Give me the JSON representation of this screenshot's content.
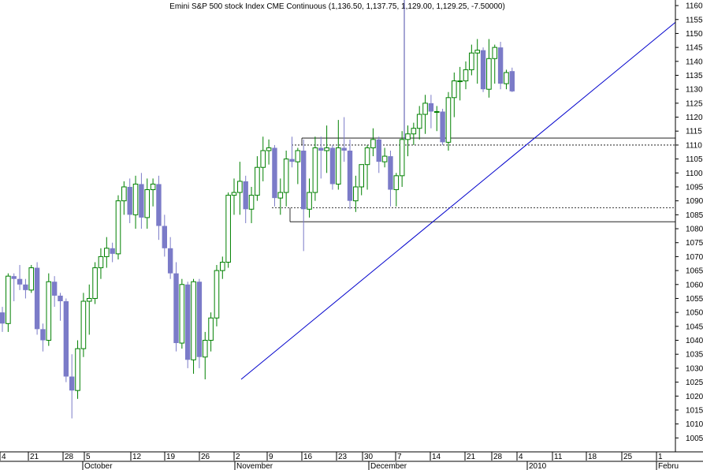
{
  "chart_data": {
    "type": "candlestick",
    "title": "Emini S&P 500 stock Index CME Continuous (1,136.50, 1,137.75, 1,129.00, 1,129.25, -7.50000)",
    "y_range": [
      1000,
      1162
    ],
    "y_ticks": [
      1005,
      1010,
      1015,
      1020,
      1025,
      1030,
      1035,
      1040,
      1045,
      1050,
      1055,
      1060,
      1065,
      1070,
      1075,
      1080,
      1085,
      1090,
      1095,
      1100,
      1105,
      1110,
      1115,
      1120,
      1125,
      1130,
      1135,
      1140,
      1145,
      1150,
      1155,
      1160
    ],
    "x_day_labels": [
      "4",
      "21",
      "28",
      "5",
      "12",
      "19",
      "26",
      "2",
      "9",
      "16",
      "23",
      "30",
      "7",
      "14",
      "21",
      "28",
      "4",
      "11",
      "18",
      "25",
      "1"
    ],
    "x_month_labels": [
      "October",
      "November",
      "December",
      "2010",
      "Febru"
    ],
    "colors": {
      "up": "#008000",
      "down": "#7b7bc8",
      "trendline": "#0000cc",
      "level": "#000000"
    },
    "candles": [
      [
        1050,
        1052,
        1043,
        1046
      ],
      [
        1046,
        1064,
        1043,
        1063
      ],
      [
        1063,
        1064,
        1054,
        1062
      ],
      [
        1062,
        1067,
        1058,
        1060
      ],
      [
        1060,
        1062,
        1055,
        1058
      ],
      [
        1058,
        1067,
        1057,
        1066
      ],
      [
        1066,
        1068,
        1042,
        1044
      ],
      [
        1044,
        1046,
        1036,
        1040
      ],
      [
        1040,
        1064,
        1038,
        1061
      ],
      [
        1061,
        1063,
        1052,
        1056
      ],
      [
        1056,
        1057,
        1047,
        1054
      ],
      [
        1054,
        1055,
        1025,
        1027
      ],
      [
        1027,
        1035,
        1012,
        1022
      ],
      [
        1022,
        1040,
        1019,
        1037
      ],
      [
        1037,
        1057,
        1034,
        1054
      ],
      [
        1054,
        1060,
        1042,
        1055
      ],
      [
        1055,
        1068,
        1053,
        1066
      ],
      [
        1066,
        1073,
        1062,
        1070
      ],
      [
        1070,
        1077,
        1066,
        1073
      ],
      [
        1073,
        1075,
        1068,
        1071
      ],
      [
        1071,
        1092,
        1069,
        1090
      ],
      [
        1090,
        1097,
        1085,
        1095
      ],
      [
        1095,
        1098,
        1082,
        1085
      ],
      [
        1085,
        1099,
        1080,
        1096
      ],
      [
        1096,
        1100,
        1080,
        1084
      ],
      [
        1084,
        1098,
        1080,
        1094
      ],
      [
        1094,
        1098,
        1088,
        1096
      ],
      [
        1096,
        1099,
        1076,
        1081
      ],
      [
        1081,
        1085,
        1070,
        1073
      ],
      [
        1073,
        1077,
        1062,
        1064
      ],
      [
        1064,
        1068,
        1036,
        1039
      ],
      [
        1039,
        1062,
        1037,
        1060
      ],
      [
        1060,
        1061,
        1030,
        1033
      ],
      [
        1033,
        1062,
        1028,
        1061
      ],
      [
        1061,
        1062,
        1030,
        1034
      ],
      [
        1034,
        1043,
        1026,
        1040
      ],
      [
        1040,
        1050,
        1036,
        1048
      ],
      [
        1048,
        1067,
        1045,
        1065
      ],
      [
        1065,
        1070,
        1062,
        1068
      ],
      [
        1068,
        1093,
        1066,
        1092
      ],
      [
        1092,
        1098,
        1085,
        1093
      ],
      [
        1093,
        1104,
        1085,
        1097
      ],
      [
        1097,
        1099,
        1082,
        1087
      ],
      [
        1087,
        1095,
        1082,
        1092
      ],
      [
        1092,
        1106,
        1090,
        1102
      ],
      [
        1102,
        1113,
        1097,
        1108
      ],
      [
        1108,
        1112,
        1103,
        1109
      ],
      [
        1109,
        1110,
        1088,
        1091
      ],
      [
        1091,
        1098,
        1085,
        1093
      ],
      [
        1093,
        1108,
        1088,
        1105
      ],
      [
        1105,
        1113,
        1102,
        1104
      ],
      [
        1104,
        1109,
        1096,
        1108
      ],
      [
        1108,
        1112,
        1072,
        1087
      ],
      [
        1087,
        1098,
        1084,
        1093
      ],
      [
        1093,
        1113,
        1090,
        1109
      ],
      [
        1109,
        1113,
        1098,
        1108
      ],
      [
        1108,
        1117,
        1100,
        1109
      ],
      [
        1109,
        1110,
        1094,
        1096
      ],
      [
        1096,
        1119,
        1094,
        1109
      ],
      [
        1109,
        1120,
        1104,
        1108
      ],
      [
        1108,
        1112,
        1087,
        1090
      ],
      [
        1090,
        1099,
        1086,
        1095
      ],
      [
        1095,
        1102,
        1092,
        1103
      ],
      [
        1103,
        1110,
        1094,
        1109
      ],
      [
        1109,
        1116,
        1106,
        1112
      ],
      [
        1112,
        1113,
        1100,
        1104
      ],
      [
        1104,
        1109,
        1102,
        1106
      ],
      [
        1106,
        1108,
        1088,
        1094
      ],
      [
        1094,
        1100,
        1088,
        1099
      ],
      [
        1099,
        1115,
        1095,
        1112
      ],
      [
        1112,
        1117,
        1106,
        1114
      ],
      [
        1114,
        1118,
        1110,
        1116
      ],
      [
        1116,
        1124,
        1112,
        1121
      ],
      [
        1121,
        1128,
        1114,
        1125
      ],
      [
        1125,
        1128,
        1116,
        1122
      ],
      [
        1122,
        1124,
        1115,
        1122
      ],
      [
        1122,
        1123,
        1110,
        1111
      ],
      [
        1111,
        1129,
        1108,
        1127
      ],
      [
        1127,
        1136,
        1120,
        1133
      ],
      [
        1133,
        1138,
        1126,
        1133
      ],
      [
        1133,
        1140,
        1130,
        1137
      ],
      [
        1137,
        1146,
        1135,
        1143
      ],
      [
        1143,
        1148,
        1132,
        1144
      ],
      [
        1144,
        1145,
        1129,
        1130
      ],
      [
        1130,
        1148,
        1127,
        1141
      ],
      [
        1141,
        1146,
        1132,
        1145
      ],
      [
        1145,
        1147,
        1130,
        1132
      ],
      [
        1132,
        1137,
        1130,
        1136
      ],
      [
        1136.5,
        1137.75,
        1129,
        1129.25
      ]
    ],
    "reference_lines": {
      "resistance": 1112.5,
      "support": 1082.5,
      "dashed_upper": 1110,
      "dashed_lower": 1087.5
    },
    "trendline": {
      "start": {
        "candle": 35,
        "price": 1026
      },
      "end": {
        "candle": 105,
        "price": 1154
      }
    }
  }
}
